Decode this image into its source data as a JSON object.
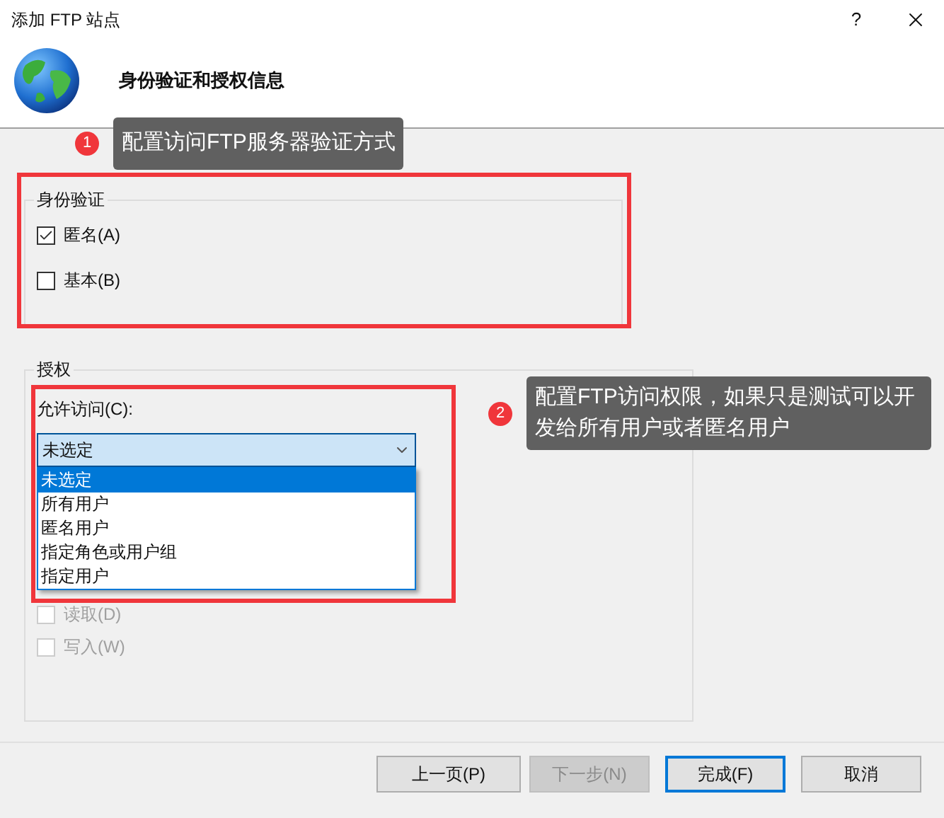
{
  "window": {
    "title": "添加 FTP 站点",
    "help": "?"
  },
  "header": {
    "title": "身份验证和授权信息"
  },
  "authentication": {
    "legend": "身份验证",
    "options": [
      {
        "label": "匿名(A)",
        "checked": true
      },
      {
        "label": "基本(B)",
        "checked": false
      }
    ]
  },
  "authorization": {
    "legend": "授权",
    "allow_label": "允许访问(C):",
    "dropdown": {
      "value": "未选定",
      "expanded": true,
      "options": [
        {
          "label": "未选定",
          "selected": true
        },
        {
          "label": "所有用户",
          "selected": false
        },
        {
          "label": "匿名用户",
          "selected": false
        },
        {
          "label": "指定角色或用户组",
          "selected": false
        },
        {
          "label": "指定用户",
          "selected": false
        }
      ]
    },
    "permissions": [
      {
        "label": "读取(D)",
        "checked": false,
        "disabled": true
      },
      {
        "label": "写入(W)",
        "checked": false,
        "disabled": true
      }
    ]
  },
  "buttons": [
    {
      "label": "上一页(P)",
      "disabled": false,
      "focused": false
    },
    {
      "label": "下一步(N)",
      "disabled": true,
      "focused": false
    },
    {
      "label": "完成(F)",
      "disabled": false,
      "focused": true
    },
    {
      "label": "取消",
      "disabled": false,
      "focused": false
    }
  ],
  "annotations": [
    {
      "number": "1",
      "text": "配置访问FTP服务器验证方式"
    },
    {
      "number": "2",
      "text": "配置FTP访问权限，如果只是测试可以开发给所有用户或者匿名用户"
    }
  ]
}
